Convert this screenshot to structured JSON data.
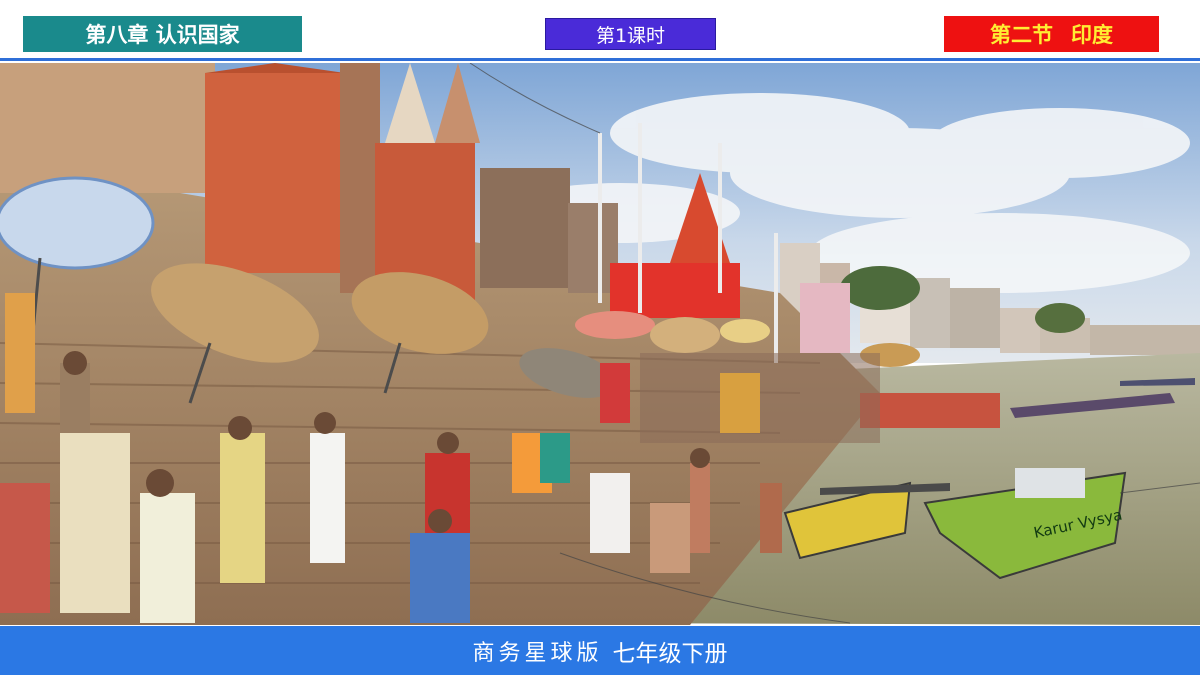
{
  "header": {
    "chapter": "第八章 认识国家",
    "lesson": "第1课时",
    "section_number": "第二节",
    "section_name": "印度"
  },
  "footer": {
    "publisher": "商务星球版",
    "grade": "七年级下册"
  },
  "photo": {
    "boat_text": "Karur Vysya"
  },
  "colors": {
    "chapter_bg": "#1a8a8c",
    "lesson_bg": "#4a2bd8",
    "section_bg": "#ee1111",
    "section_text": "#ffee33",
    "footer_bg": "#2b78e4",
    "rule": "#2f6fd8"
  }
}
